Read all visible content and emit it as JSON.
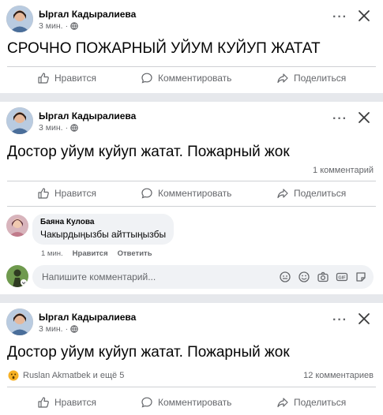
{
  "posts": [
    {
      "author": "Ыргал Кадыралиева",
      "time": "3 мин.",
      "text": "СРОЧНО ПОЖАРНЫЙ УЙУМ КУЙУП ЖАТАТ"
    },
    {
      "author": "Ыргал Кадыралиева",
      "time": "3 мин.",
      "text": "Достор уйум куйуп жатат. Пожарный жок",
      "comment_count": "1 комментарий",
      "comment": {
        "author": "Баяна Кулова",
        "text": "Чакырдыңызбы айттыңызбы",
        "time": "1 мин.",
        "like": "Нравится",
        "reply": "Ответить"
      },
      "composer_placeholder": "Напишите комментарий..."
    },
    {
      "author": "Ыргал Кадыралиева",
      "time": "3 мин.",
      "text": "Достор уйум куйуп жатат. Пожарный жок",
      "reactions": "Ruslan Akmatbek и ещё 5",
      "comment_count": "12 комментариев"
    }
  ],
  "actions": {
    "like": "Нравится",
    "comment": "Комментировать",
    "share": "Поделиться"
  },
  "more": "···",
  "colors": {
    "text": "#050505",
    "secondary": "#65676b",
    "divider": "#ced0d4",
    "bubble": "#f0f2f5",
    "background": "#e6e8ec"
  }
}
